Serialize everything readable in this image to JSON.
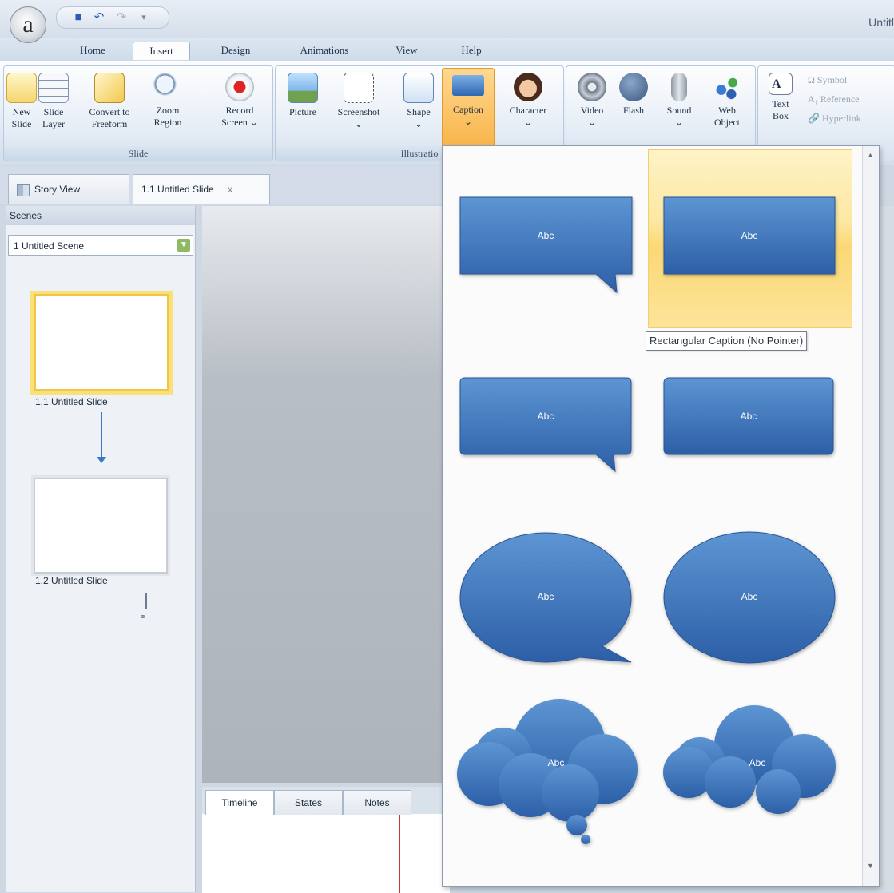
{
  "app": {
    "title": "Untitl",
    "logo_letter": "a"
  },
  "tabs": [
    "Home",
    "Insert",
    "Design",
    "Animations",
    "View",
    "Help"
  ],
  "ribbon": {
    "slide_group": {
      "label": "Slide",
      "buttons": [
        {
          "line1": "New",
          "line2": "Slide"
        },
        {
          "line1": "Slide",
          "line2": "Layer"
        },
        {
          "line1": "Convert to",
          "line2": "Freeform"
        },
        {
          "line1": "Zoom",
          "line2": "Region"
        },
        {
          "line1": "Record",
          "line2": "Screen ⌄"
        }
      ]
    },
    "illustrations_group": {
      "label": "Illustratio",
      "buttons": [
        "Picture",
        "Screenshot",
        "Shape",
        "Caption",
        "Character"
      ]
    },
    "media_group": {
      "buttons": [
        {
          "line1": "Video",
          "line2": "⌄"
        },
        {
          "line1": "Flash",
          "line2": ""
        },
        {
          "line1": "Sound",
          "line2": "⌄"
        },
        {
          "line1": "Web",
          "line2": "Object"
        }
      ]
    },
    "text_group": {
      "textbox": {
        "line1": "Text",
        "line2": "Box"
      },
      "items": [
        "Symbol",
        "Reference",
        "Hyperlink"
      ]
    }
  },
  "doc_tabs": {
    "story_view": "Story View",
    "current": "1.1 Untitled Slide",
    "close": "x"
  },
  "scenes": {
    "header": "Scenes",
    "selected_scene": "1 Untitled Scene",
    "slides": [
      "1.1 Untitled Slide",
      "1.2 Untitled Slide"
    ]
  },
  "bottom_tabs": [
    "Timeline",
    "States",
    "Notes"
  ],
  "gallery": {
    "caption_text": "Abc",
    "tooltip": "Rectangular Caption (No Pointer)"
  },
  "colors": {
    "caption_blue_top": "#5d95d3",
    "caption_blue_bottom": "#2c5fa7",
    "hover": "#fbd874",
    "selected_orange": "#f8b449"
  }
}
